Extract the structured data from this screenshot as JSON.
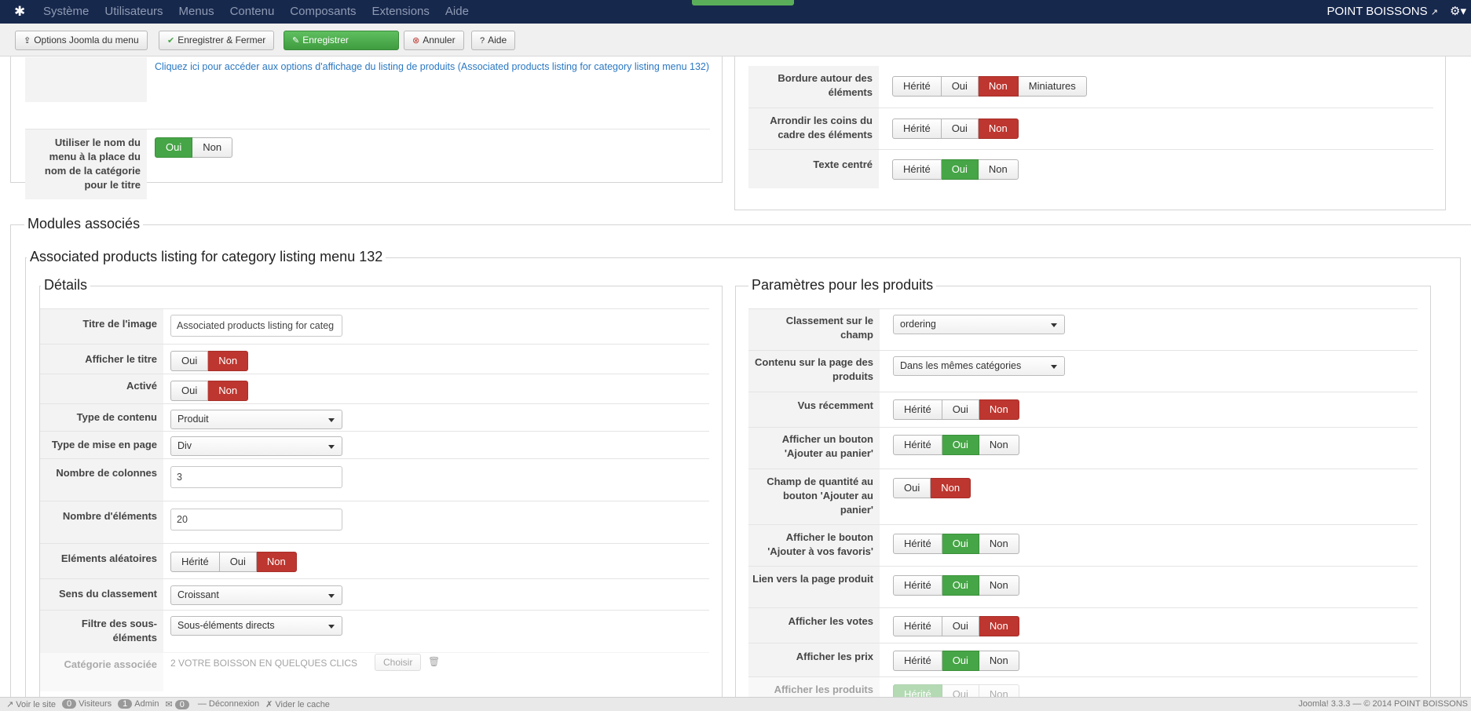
{
  "navbar": {
    "menu": [
      "Système",
      "Utilisateurs",
      "Menus",
      "Contenu",
      "Composants",
      "Extensions",
      "Aide"
    ],
    "site_name": "POINT BOISSONS",
    "icons": {
      "logo": "joomla-logo-icon",
      "external": "external-link-icon",
      "settings": "gear-icon"
    }
  },
  "toolbar": {
    "options_label": "Options Joomla du menu",
    "save_close_label": "Enregistrer & Fermer",
    "save_label": "Enregistrer",
    "cancel_label": "Annuler",
    "help_label": "Aide"
  },
  "top_left": {
    "link_text": "Cliquez ici pour accéder aux options d'affichage du listing de produits (Associated products listing for category listing menu 132)",
    "use_menu_name": {
      "label": "Utiliser le nom du menu à la place du nom de la catégorie pour le titre",
      "options": [
        "Oui",
        "Non"
      ],
      "selected": "Oui"
    }
  },
  "top_right": {
    "border": {
      "label": "Bordure autour des éléments",
      "options": [
        "Hérité",
        "Oui",
        "Non",
        "Miniatures"
      ],
      "selected": "Non"
    },
    "round": {
      "label": "Arrondir les coins du cadre des éléments",
      "options": [
        "Hérité",
        "Oui",
        "Non"
      ],
      "selected": "Non"
    },
    "centered": {
      "label": "Texte centré",
      "options": [
        "Hérité",
        "Oui",
        "Non"
      ],
      "selected": "Oui"
    }
  },
  "modules": {
    "legend": "Modules associés",
    "module_title": "Associated products listing for category listing menu 132",
    "details": {
      "legend": "Détails",
      "image_title": {
        "label": "Titre de l'image",
        "value": "Associated products listing for categ"
      },
      "show_title": {
        "label": "Afficher le titre",
        "options": [
          "Oui",
          "Non"
        ],
        "selected": "Non"
      },
      "active": {
        "label": "Activé",
        "options": [
          "Oui",
          "Non"
        ],
        "selected": "Non"
      },
      "content_type": {
        "label": "Type de contenu",
        "value": "Produit"
      },
      "layout_type": {
        "label": "Type de mise en page",
        "value": "Div"
      },
      "columns": {
        "label": "Nombre de colonnes",
        "value": "3"
      },
      "elements": {
        "label": "Nombre d'éléments",
        "value": "20"
      },
      "random": {
        "label": "Eléments aléatoires",
        "options": [
          "Hérité",
          "Oui",
          "Non"
        ],
        "selected": "Non"
      },
      "sort_dir": {
        "label": "Sens du classement",
        "value": "Croissant"
      },
      "filter": {
        "label": "Filtre des sous-éléments",
        "value": "Sous-éléments directs"
      },
      "category": {
        "label": "Catégorie associée",
        "value": "2 VOTRE BOISSON EN QUELQUES CLICS",
        "button": "Choisir"
      }
    },
    "products": {
      "legend": "Paramètres pour les produits",
      "ordering": {
        "label": "Classement sur le champ",
        "value": "ordering"
      },
      "page_content": {
        "label": "Contenu sur la page des produits",
        "value": "Dans les mêmes catégories"
      },
      "recent": {
        "label": "Vus récemment",
        "options": [
          "Hérité",
          "Oui",
          "Non"
        ],
        "selected": "Non"
      },
      "add_cart": {
        "label": "Afficher un bouton 'Ajouter au panier'",
        "options": [
          "Hérité",
          "Oui",
          "Non"
        ],
        "selected": "Oui"
      },
      "qty_field": {
        "label": "Champ de quantité au bouton 'Ajouter au panier'",
        "options": [
          "Oui",
          "Non"
        ],
        "selected": "Non"
      },
      "wishlist": {
        "label": "Afficher le bouton 'Ajouter à vos favoris'",
        "options": [
          "Hérité",
          "Oui",
          "Non"
        ],
        "selected": "Oui"
      },
      "link": {
        "label": "Lien vers la page produit",
        "options": [
          "Hérité",
          "Oui",
          "Non"
        ],
        "selected": "Oui"
      },
      "votes": {
        "label": "Afficher les votes",
        "options": [
          "Hérité",
          "Oui",
          "Non"
        ],
        "selected": "Non"
      },
      "prices": {
        "label": "Afficher les prix",
        "options": [
          "Hérité",
          "Oui",
          "Non"
        ],
        "selected": "Oui"
      },
      "show_products": {
        "label": "Afficher les produits",
        "options": [
          "Hérité",
          "Oui",
          "Non"
        ],
        "selected": "Hérité"
      }
    }
  },
  "statusbar": {
    "view_site": "Voir le site",
    "visitors_count": "0",
    "visitors": "Visiteurs",
    "admin_count": "1",
    "admin": "Admin",
    "messages_count": "0",
    "logout": "Déconnexion",
    "clear_cache": "Vider le cache",
    "version": "Joomla! 3.3.3 — © 2014 POINT BOISSONS"
  },
  "colors": {
    "navbar": "#17284d",
    "green": "#46a546",
    "red": "#bd362f",
    "link": "#2a78c2"
  }
}
